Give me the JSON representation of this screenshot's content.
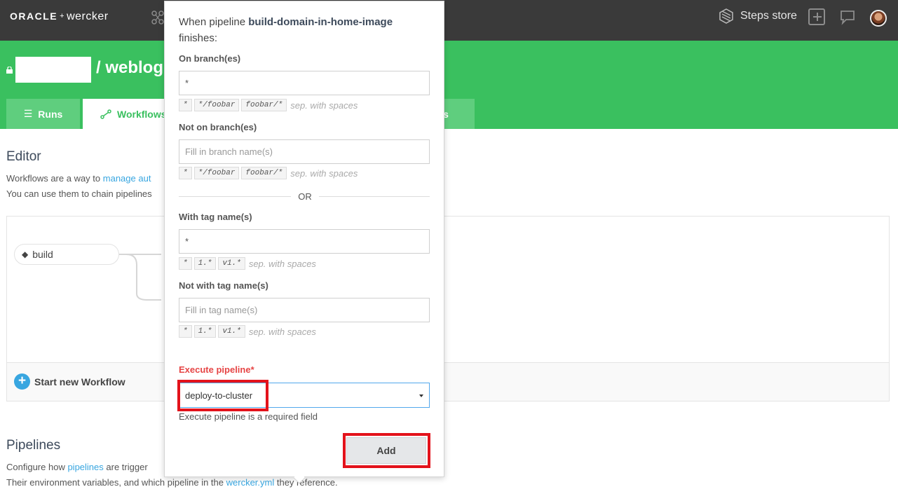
{
  "topbar": {
    "brand_oracle": "ORACLE",
    "brand_plus": "+",
    "brand_wercker": "wercker",
    "steps_store": "Steps store"
  },
  "header": {
    "repo_title": "/ weblogic",
    "tabs": {
      "runs": "Runs",
      "workflows": "Workflows",
      "options": "ons"
    }
  },
  "editor": {
    "heading": "Editor",
    "line1_prefix": "Workflows are a way to ",
    "line1_link": "manage aut",
    "line2": "You can use them to chain pipelines",
    "node_build": "build",
    "start_new": "Start new Workflow"
  },
  "pipelines": {
    "heading": "Pipelines",
    "line1_prefix": "Configure how ",
    "line1_link": "pipelines",
    "line1_suffix": " are trigger",
    "line2_prefix": "Their environment variables, and which pipeline in the ",
    "line2_link": "wercker.yml",
    "line2_suffix": " they reference."
  },
  "popup": {
    "title_prefix": "When pipeline ",
    "pipeline_name": "build-domain-in-home-image",
    "title_suffix": "finishes:",
    "on_branches": {
      "label": "On branch(es)",
      "value": "*",
      "hints": [
        "*",
        "*/foobar",
        "foobar/*"
      ],
      "sep": "sep. with spaces"
    },
    "not_on_branches": {
      "label": "Not on branch(es)",
      "placeholder": "Fill in branch name(s)",
      "hints": [
        "*",
        "*/foobar",
        "foobar/*"
      ],
      "sep": "sep. with spaces"
    },
    "or": "OR",
    "with_tags": {
      "label": "With tag name(s)",
      "value": "*",
      "hints": [
        "*",
        "1.*",
        "v1.*"
      ],
      "sep": "sep. with spaces"
    },
    "not_with_tags": {
      "label": "Not with tag name(s)",
      "placeholder": "Fill in tag name(s)",
      "hints": [
        "*",
        "1.*",
        "v1.*"
      ],
      "sep": "sep. with spaces"
    },
    "execute": {
      "label": "Execute pipeline*",
      "selected": "deploy-to-cluster",
      "help": "Execute pipeline is a required field"
    },
    "add_button": "Add"
  },
  "colors": {
    "topbar": "#3a3a3a",
    "brand_green": "#3ac05f",
    "link": "#38a6e0",
    "required": "#e64545",
    "highlight": "#e3121b"
  }
}
